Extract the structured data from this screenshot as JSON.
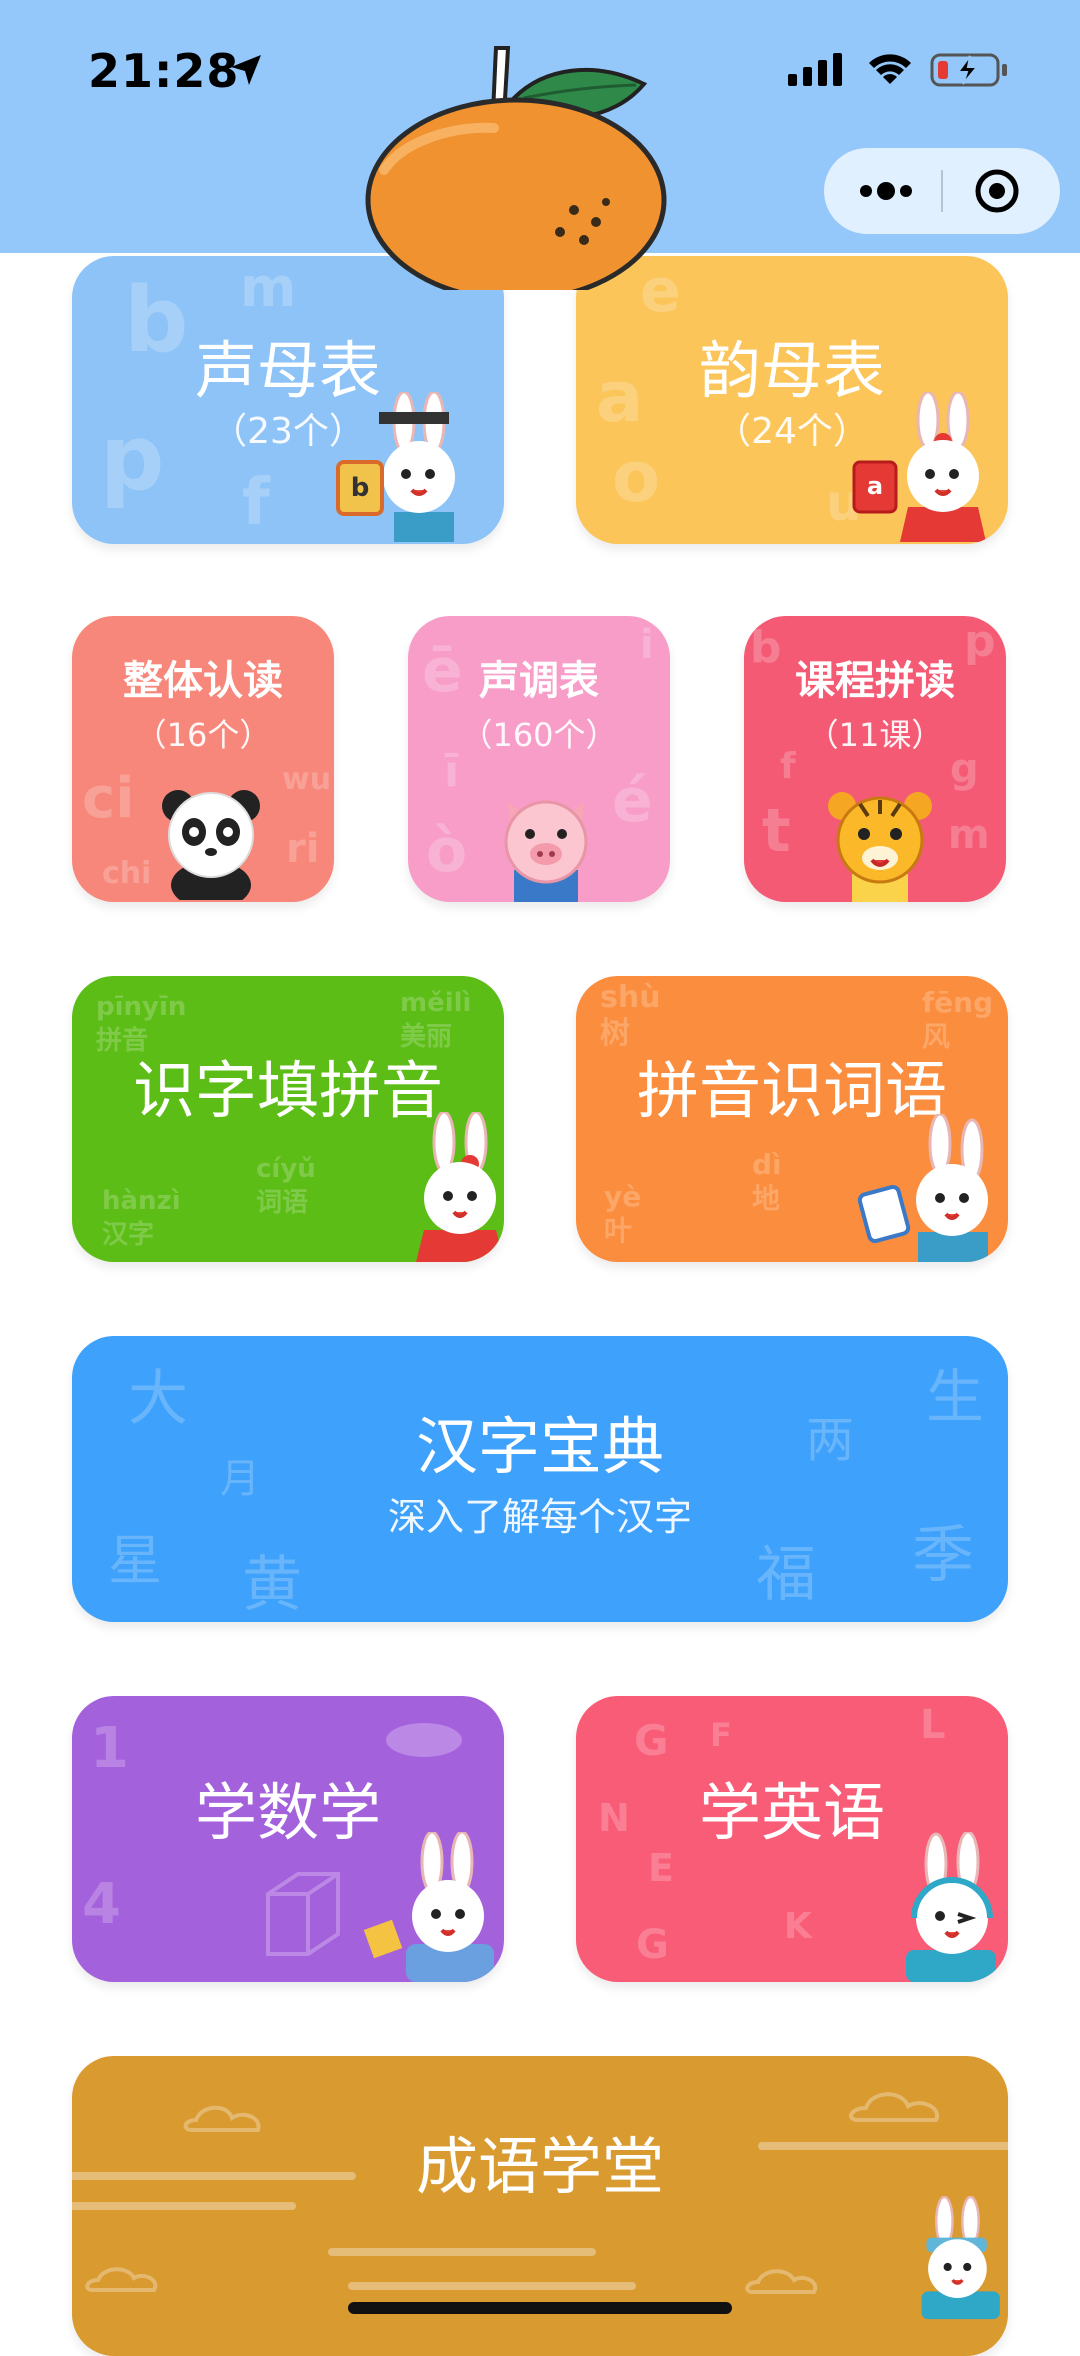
{
  "status_bar": {
    "time": "21:28"
  },
  "cards": {
    "shengmu": {
      "title": "声母表",
      "sub": "（23个）",
      "color": "#8ec3f7"
    },
    "yunmu": {
      "title": "韵母表",
      "sub": "（24个）",
      "color": "#fbc55a"
    },
    "zhengti": {
      "title": "整体认读",
      "sub": "（16个）",
      "color": "#f7877a"
    },
    "shengdiao": {
      "title": "声调表",
      "sub": "（160个）",
      "color": "#f79dc8"
    },
    "kecheng": {
      "title": "课程拼读",
      "sub": "（11课）",
      "color": "#f45a74"
    },
    "shizi": {
      "title": "识字填拼音",
      "color": "#5cbd16"
    },
    "pinyin_ciyu": {
      "title": "拼音识词语",
      "color": "#fb8d3e"
    },
    "hanzi": {
      "title": "汉字宝典",
      "sub": "深入了解每个汉字",
      "color": "#3ea1fb"
    },
    "shuxue": {
      "title": "学数学",
      "color": "#a461dc"
    },
    "yingyu": {
      "title": "学英语",
      "color": "#f95c76"
    },
    "chengyu": {
      "title": "成语学堂",
      "color": "#d99a30"
    }
  },
  "deco_letters": {
    "shengmu": [
      "b",
      "m",
      "p",
      "f"
    ],
    "yunmu": [
      "e",
      "a",
      "o",
      "u"
    ],
    "zhengti": [
      "ci",
      "chi",
      "wu",
      "ri"
    ],
    "shengdiao": [
      "ē",
      "ī",
      "ò",
      "é",
      "i"
    ],
    "kecheng": [
      "b",
      "t",
      "g",
      "m",
      "p",
      "f"
    ],
    "shizi": [
      "pīnyīn 拼音",
      "měilì 美丽",
      "cíyǔ 词语",
      "hànzì 汉字"
    ],
    "pinyin_ciyu": [
      "shù 树",
      "fēng 风",
      "dì 地",
      "yè 叶"
    ],
    "hanzi": [
      "大",
      "月",
      "星",
      "黄",
      "两",
      "生",
      "福",
      "季"
    ],
    "shuxue": [
      "1",
      "4"
    ],
    "yingyu": [
      "G",
      "F",
      "L",
      "N",
      "E",
      "G",
      "K"
    ]
  },
  "icons": {
    "location": "location-arrow-icon",
    "signal": "cellular-signal-icon",
    "wifi": "wifi-icon",
    "battery": "battery-charging-icon",
    "more": "more-dots-icon",
    "close": "target-close-icon"
  }
}
